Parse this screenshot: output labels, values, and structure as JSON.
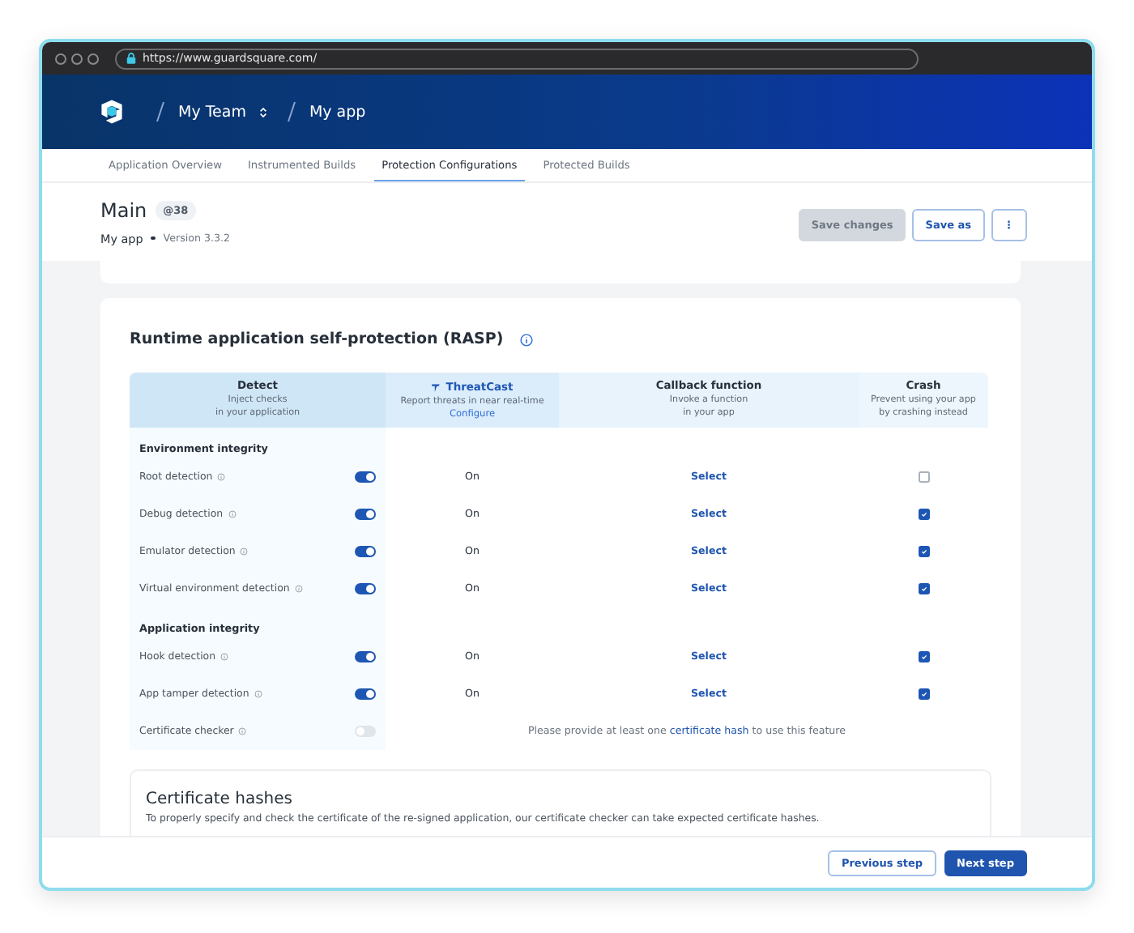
{
  "browser": {
    "url": "https://www.guardsquare.com/"
  },
  "header": {
    "breadcrumbs": [
      {
        "label": "My Team",
        "kind": "switcher"
      },
      {
        "label": "My app",
        "kind": "plain"
      }
    ]
  },
  "tabs": [
    {
      "label": "Application Overview",
      "selected": false
    },
    {
      "label": "Instrumented Builds",
      "selected": false
    },
    {
      "label": "Protection Configurations",
      "selected": true
    },
    {
      "label": "Protected Builds",
      "selected": false
    }
  ],
  "page": {
    "title": "Main",
    "badge": "@38",
    "app": "My app",
    "version": "Version 3.3.2",
    "buttons": [
      {
        "label": "Save changes",
        "kind": "primary",
        "disabled": true
      },
      {
        "label": "Save as",
        "kind": "outline",
        "disabled": false
      },
      {
        "label": "⋮",
        "kind": "outline",
        "disabled": false
      }
    ]
  },
  "rasp": {
    "title": "Runtime application self-protection (RASP)",
    "columns": [
      {
        "title": "Detect",
        "subtitle": "Inject checks\nin your application",
        "kind": "detect"
      },
      {
        "title": "ThreatCast",
        "subtitle": "Report threats in near real-time",
        "link": "Configure",
        "kind": "threatcast"
      },
      {
        "title": "Callback function",
        "subtitle": "Invoke a function\nin your app",
        "kind": "callback"
      },
      {
        "title": "Crash",
        "subtitle": "Prevent using your app\nby crashing instead",
        "kind": "crash"
      }
    ],
    "groups": [
      {
        "title": "Environment integrity",
        "rows": [
          {
            "name": "Root detection",
            "kind": "check",
            "enabled": true,
            "threatcast": "On",
            "callback": "Select",
            "crash": false
          },
          {
            "name": "Debug detection",
            "kind": "check",
            "enabled": true,
            "threatcast": "On",
            "callback": "Select",
            "crash": true
          },
          {
            "name": "Emulator detection",
            "kind": "check",
            "enabled": true,
            "threatcast": "On",
            "callback": "Select",
            "crash": true
          },
          {
            "name": "Virtual environment detection",
            "kind": "check",
            "enabled": true,
            "threatcast": "On",
            "callback": "Select",
            "crash": true
          }
        ]
      },
      {
        "title": "Application integrity",
        "rows": [
          {
            "name": "Hook detection",
            "kind": "check",
            "enabled": true,
            "threatcast": "On",
            "callback": "Select",
            "crash": true
          },
          {
            "name": "App tamper detection",
            "kind": "check",
            "enabled": true,
            "threatcast": "On",
            "callback": "Select",
            "crash": true
          },
          {
            "name": "Certificate checker",
            "kind": "notice",
            "enabled": false,
            "notice": {
              "before": "Please provide at least one ",
              "link": "certificate hash",
              "after": " to use this feature"
            }
          }
        ]
      }
    ]
  },
  "certificate_hashes": {
    "title": "Certificate hashes",
    "description": "To properly specify and check the certificate of the re-signed application, our certificate checker can take expected certificate hashes."
  },
  "footer": {
    "buttons": [
      {
        "label": "Previous step",
        "kind": "outline"
      },
      {
        "label": "Next step",
        "kind": "primary"
      }
    ]
  }
}
